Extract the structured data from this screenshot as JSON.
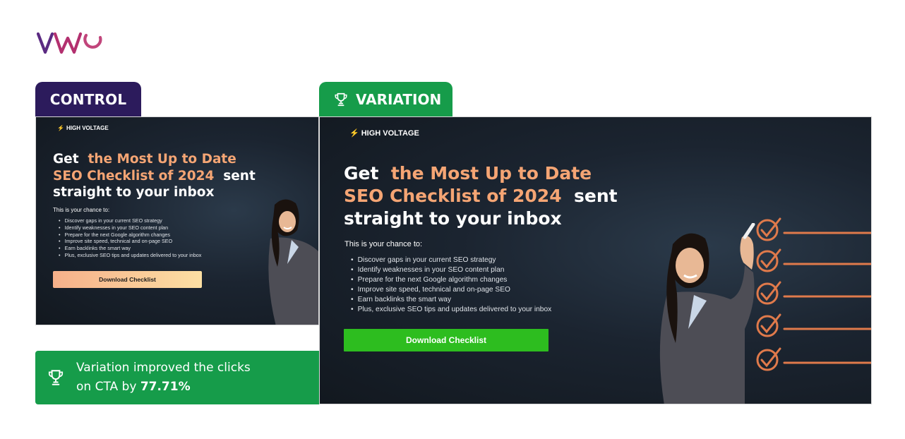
{
  "logo": {
    "text": "VWO",
    "colors": {
      "v": "#5b2b82",
      "w": "#b3306f",
      "o": "#c1457b"
    }
  },
  "tabs": {
    "control": {
      "label": "CONTROL",
      "color": "#2c1b5c"
    },
    "variation": {
      "label": "VARIATION",
      "icon": "trophy-icon",
      "color": "#169c4a"
    }
  },
  "landing_page": {
    "brand": "HIGH VOLTAGE",
    "headline_prefix": "Get",
    "headline_highlight_1": "the Most Up to Date",
    "headline_highlight_2": "SEO Checklist of 2024",
    "headline_suffix_1": "sent",
    "headline_suffix_2": "straight to your inbox",
    "intro": "This is your chance to:",
    "bullets": [
      "Discover gaps in your current SEO strategy",
      "Identify weaknesses in your SEO content plan",
      "Prepare for the next Google algorithm changes",
      "Improve site speed, technical and on-page SEO",
      "Earn backlinks the smart way",
      "Plus, exclusive SEO tips and updates delivered to your inbox"
    ],
    "highlight_color": "#f5a574"
  },
  "control": {
    "cta_label": "Download Checklist"
  },
  "variation": {
    "cta_label": "Download Checklist",
    "cta_color": "#2dbd1f"
  },
  "result": {
    "text_prefix": "Variation improved the clicks",
    "text_line2": "on CTA by",
    "value": "77.71%",
    "icon": "trophy-icon"
  }
}
